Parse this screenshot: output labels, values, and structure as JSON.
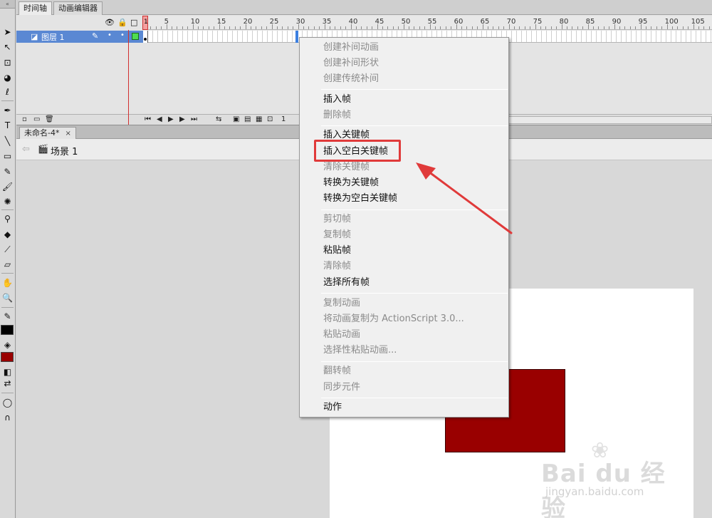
{
  "timeline": {
    "tabs": [
      {
        "label": "时间轴",
        "active": true
      },
      {
        "label": "动画编辑器",
        "active": false
      }
    ],
    "header_icons": [
      "eye-icon",
      "lock-icon",
      "outline-icon"
    ],
    "frame_numbers": [
      "1",
      "5",
      "10",
      "15",
      "20",
      "25",
      "30",
      "35",
      "40",
      "45",
      "50",
      "55",
      "60",
      "65",
      "70",
      "75",
      "80",
      "85",
      "90",
      "95",
      "100",
      "105"
    ],
    "playhead_frame": "1",
    "layer": {
      "name": "图层 1",
      "outline_color": "#4fdc4f"
    },
    "current_frame_readout": "1"
  },
  "document": {
    "tab_label": "未命名-4*",
    "tab_close": "×",
    "scene_label": "场景 1"
  },
  "stage": {
    "background": "#ffffff",
    "shape_fill": "#990000"
  },
  "context_menu": {
    "groups": [
      [
        {
          "label": "创建补间动画",
          "enabled": false
        },
        {
          "label": "创建补间形状",
          "enabled": false
        },
        {
          "label": "创建传统补间",
          "enabled": false
        }
      ],
      [
        {
          "label": "插入帧",
          "enabled": true
        },
        {
          "label": "删除帧",
          "enabled": false
        }
      ],
      [
        {
          "label": "插入关键帧",
          "enabled": true
        },
        {
          "label": "插入空白关键帧",
          "enabled": true,
          "highlighted": true
        },
        {
          "label": "清除关键帧",
          "enabled": false
        },
        {
          "label": "转换为关键帧",
          "enabled": true
        },
        {
          "label": "转换为空白关键帧",
          "enabled": true
        }
      ],
      [
        {
          "label": "剪切帧",
          "enabled": false
        },
        {
          "label": "复制帧",
          "enabled": false
        },
        {
          "label": "粘贴帧",
          "enabled": true
        },
        {
          "label": "清除帧",
          "enabled": false
        },
        {
          "label": "选择所有帧",
          "enabled": true
        }
      ],
      [
        {
          "label": "复制动画",
          "enabled": false
        },
        {
          "label": "将动画复制为 ActionScript 3.0...",
          "enabled": false
        },
        {
          "label": "粘贴动画",
          "enabled": false
        },
        {
          "label": "选择性粘贴动画...",
          "enabled": false
        }
      ],
      [
        {
          "label": "翻转帧",
          "enabled": false
        },
        {
          "label": "同步元件",
          "enabled": false
        }
      ],
      [
        {
          "label": "动作",
          "enabled": true
        }
      ]
    ]
  },
  "annotation": {
    "color": "#e03a3a"
  },
  "watermark": {
    "logo": "Bai du 经验",
    "url": "jingyan.baidu.com"
  },
  "toolbar": {
    "stroke_color": "#000000",
    "fill_color": "#990000"
  }
}
